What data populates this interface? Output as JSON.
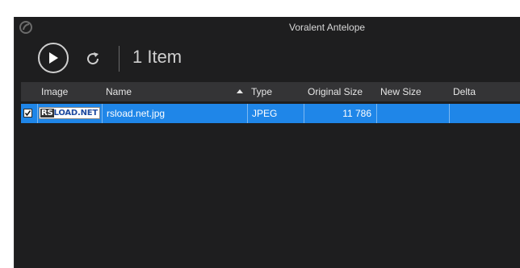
{
  "window": {
    "title": "Voralent Antelope"
  },
  "toolbar": {
    "item_count": "1 Item"
  },
  "grid": {
    "columns": [
      "Image",
      "Name",
      "Type",
      "Original Size",
      "New Size",
      "Delta"
    ],
    "sort_column": "Name",
    "sort_direction": "ascending",
    "rows": [
      {
        "checked": true,
        "thumbnail_text_a": "RS",
        "thumbnail_text_b": "LOAD.NET",
        "name": "rsload.net.jpg",
        "type": "JPEG",
        "original_size": "11 786",
        "new_size": "",
        "delta": ""
      }
    ]
  },
  "colors": {
    "background": "#1e1e1f",
    "header": "#343436",
    "selection": "#1f86e8"
  }
}
